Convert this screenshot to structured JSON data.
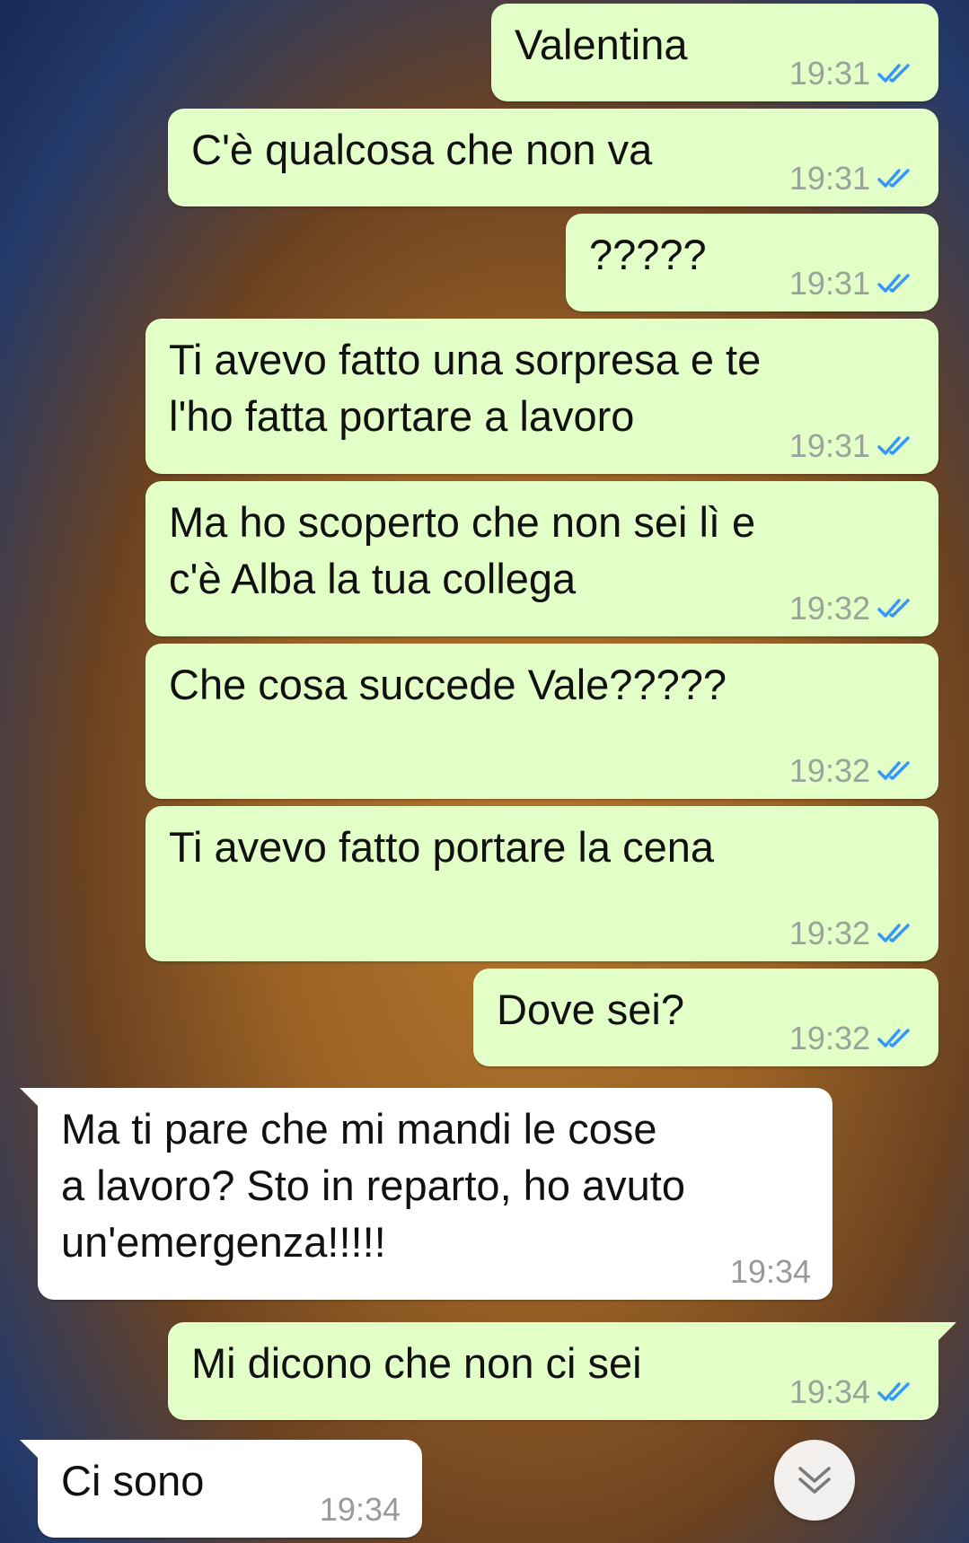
{
  "chat": {
    "messages": [
      {
        "direction": "out",
        "text": "Valentina",
        "time": "19:31",
        "status": "read"
      },
      {
        "direction": "out",
        "text": "C'è qualcosa che non va",
        "time": "19:31",
        "status": "read"
      },
      {
        "direction": "out",
        "text": "?????",
        "time": "19:31",
        "status": "read"
      },
      {
        "direction": "out",
        "text": "Ti avevo fatto una sorpresa e te\nl'ho fatta portare a lavoro",
        "time": "19:31",
        "status": "read"
      },
      {
        "direction": "out",
        "text": "Ma ho scoperto che non sei lì e\nc'è Alba la tua collega",
        "time": "19:32",
        "status": "read"
      },
      {
        "direction": "out",
        "text": "Che cosa succede Vale?????",
        "time": "19:32",
        "status": "read"
      },
      {
        "direction": "out",
        "text": "Ti avevo fatto portare la cena",
        "time": "19:32",
        "status": "read"
      },
      {
        "direction": "out",
        "text": "Dove sei?",
        "time": "19:32",
        "status": "read"
      },
      {
        "direction": "in",
        "text": "Ma ti pare che mi mandi le cose\na lavoro? Sto in reparto, ho avuto\nun'emergenza!!!!!",
        "time": "19:34"
      },
      {
        "direction": "out",
        "text": "Mi dicono che non ci sei",
        "time": "19:34",
        "status": "read"
      },
      {
        "direction": "in",
        "text": "Ci sono",
        "time": "19:34"
      }
    ]
  },
  "colors": {
    "outgoing_bubble": "#e2ffc7",
    "incoming_bubble": "#ffffff",
    "read_ticks": "#3497f9",
    "timestamp": "#9aa29a"
  },
  "icons": {
    "read_status": "double-check-icon",
    "scroll": "chevron-double-down-icon"
  }
}
